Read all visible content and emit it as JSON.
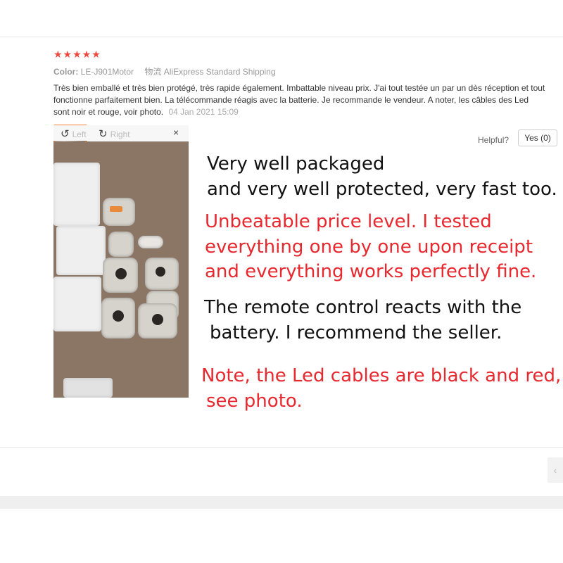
{
  "review": {
    "stars": "★★★★★",
    "color_label": "Color:",
    "color_value": "LE-J901Motor",
    "shipping_label": "物流",
    "shipping_value": "AliExpress Standard Shipping",
    "text": "Très bien emballé et très bien protégé, très rapide également. Imbattable niveau prix. J'ai tout testée un par un dès réception et tout fonctionne parfaitement bien. La télécommande réagis avec la batterie. Je recommande le vendeur. A noter, les câbles des Led sont noir et rouge, voir photo.",
    "date": "04 Jan 2021 15:09",
    "helpful_label": "Helpful?",
    "yes_button": "Yes (0)"
  },
  "viewer": {
    "rotate_left_icon": "rotate-left-icon",
    "rotate_left": "Left",
    "rotate_right_icon": "rotate-right-icon",
    "rotate_right": "Right",
    "close": "×"
  },
  "translation": {
    "line1": "Very well packaged",
    "line2": "and very well protected, very fast too.",
    "line3": "Unbeatable price level. I tested",
    "line4": "everything one by one upon receipt",
    "line5": "and everything works perfectly fine.",
    "line6": "The remote control reacts with the",
    "line7": "battery. I recommend the seller.",
    "line8": "Note, the Led cables are black and red,",
    "line9": "see photo.",
    "colors": {
      "black": "#111111",
      "red": "#e8282f"
    }
  },
  "pager": {
    "prev_icon": "chevron-left-icon",
    "prev_glyph": "‹"
  },
  "accent": {
    "stars": "#f0483e",
    "thumb_border": "#f0873a"
  }
}
